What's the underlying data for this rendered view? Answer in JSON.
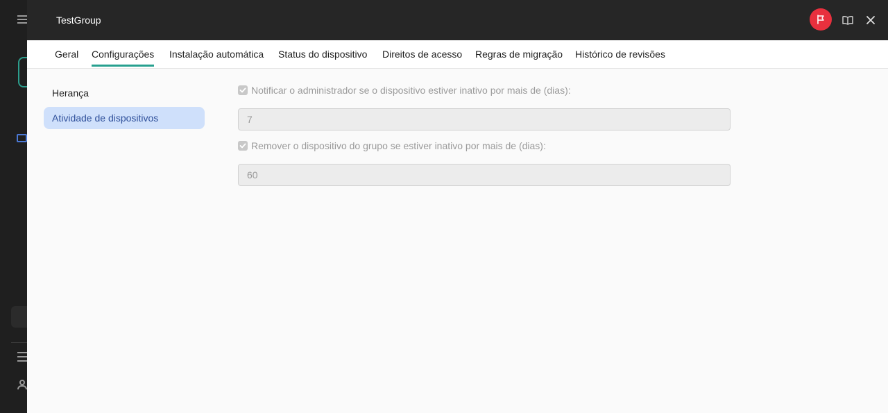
{
  "window": {
    "title": "TestGroup"
  },
  "tabs": [
    {
      "label": "Geral"
    },
    {
      "label": "Configurações"
    },
    {
      "label": "Instalação automática"
    },
    {
      "label": "Status do dispositivo"
    },
    {
      "label": "Direitos de acesso"
    },
    {
      "label": "Regras de migração"
    },
    {
      "label": "Histórico de revisões"
    }
  ],
  "active_tab": "Configurações",
  "sidebar": {
    "items": [
      {
        "label": "Herança"
      },
      {
        "label": "Atividade de dispositivos"
      }
    ],
    "selected": "Atividade de dispositivos"
  },
  "settings": {
    "notify": {
      "label": "Notificar o administrador se o dispositivo estiver inativo por mais de (dias):",
      "checked": true,
      "value": "7"
    },
    "remove": {
      "label": "Remover o dispositivo do grupo se estiver inativo por mais de (dias):",
      "checked": true,
      "value": "60"
    }
  },
  "icons": {
    "flag": "flag-icon",
    "guide": "book-icon",
    "close": "close-icon"
  },
  "colors": {
    "accent": "#27a08f",
    "selected_bg": "#cfe0fb",
    "selected_text": "#2e4f9a",
    "flag_bg": "#e8303e",
    "titlebar_bg": "#262626"
  }
}
